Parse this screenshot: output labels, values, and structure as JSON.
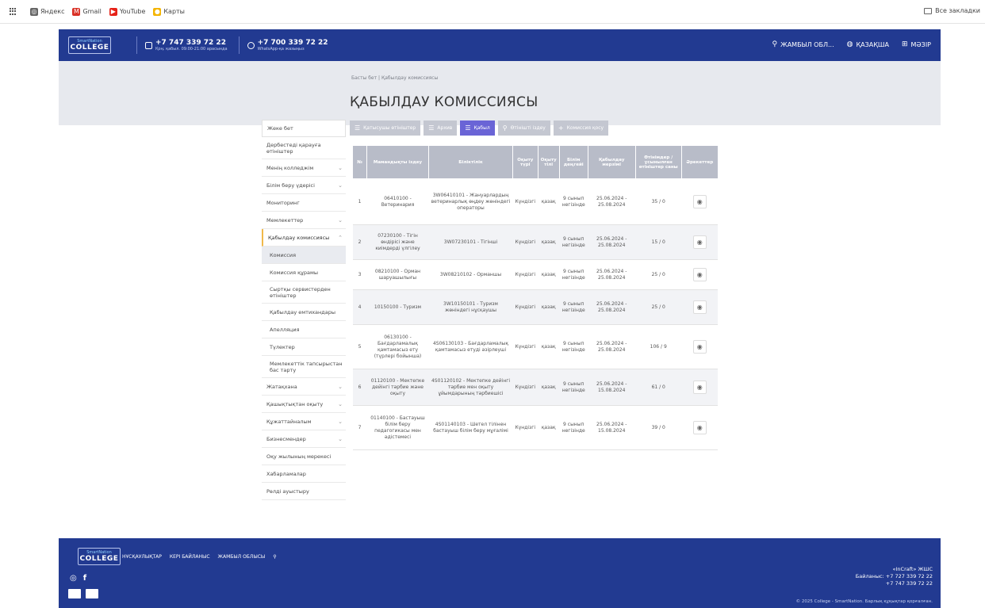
{
  "browser": {
    "bookmarks": [
      {
        "label": "Яндекс",
        "icon": "yandex-icon",
        "color": "#666666",
        "glyph": "◎"
      },
      {
        "label": "Gmail",
        "icon": "gmail-icon",
        "color": "#d93025",
        "glyph": "M"
      },
      {
        "label": "YouTube",
        "icon": "youtube-icon",
        "color": "#e62117",
        "glyph": "▶"
      },
      {
        "label": "Карты",
        "icon": "maps-pin-icon",
        "color": "#f4b400",
        "glyph": "●"
      }
    ],
    "all_bookmarks": "Все закладки"
  },
  "header": {
    "logo_brand": "SmartNation",
    "logo_word": "COLLEGE",
    "phone1": "+7 747 339 72 22",
    "phone1_sub": "Қоң. қабыл. 09:00-21:00 арасында",
    "phone2": "+7 700 339 72 22",
    "phone2_sub": "WhatsApp-қа жазыңыз",
    "region": "ЖАМБЫЛ ОБЛ...",
    "language": "ҚАЗАҚША",
    "menu": "МӘЗІР"
  },
  "page": {
    "breadcrumb": "Басты бет  |  Қабылдау комиссиясы",
    "title": "ҚАБЫЛДАУ КОМИССИЯСЫ"
  },
  "sidebar": {
    "items": [
      {
        "label": "Жеке бет",
        "chevron": ""
      },
      {
        "label": "Дербестеді қарауға өтініштер",
        "chevron": ""
      },
      {
        "label": "Менің колледжім",
        "chevron": "⌄"
      },
      {
        "label": "Білім беру үдерісі",
        "chevron": "⌄"
      },
      {
        "label": "Мониторинг",
        "chevron": ""
      },
      {
        "label": "Мемлекеттер",
        "chevron": "⌄"
      },
      {
        "label": "Қабылдау комиссиясы",
        "chevron": "⌃"
      },
      {
        "label": "Комиссия",
        "chevron": ""
      },
      {
        "label": "Комиссия құрамы",
        "chevron": ""
      },
      {
        "label": "Сыртқы сервистерден өтініштер",
        "chevron": ""
      },
      {
        "label": "Қабылдау емтихандары",
        "chevron": ""
      },
      {
        "label": "Апелляция",
        "chevron": ""
      },
      {
        "label": "Түлектер",
        "chevron": ""
      },
      {
        "label": "Мемлекеттік тапсырыстан бас тарту",
        "chevron": ""
      },
      {
        "label": "Жатақхана",
        "chevron": "⌄"
      },
      {
        "label": "Қашықтықтан оқыту",
        "chevron": "⌄"
      },
      {
        "label": "Құжаттайналым",
        "chevron": "⌄"
      },
      {
        "label": "Бизнесмендер",
        "chevron": "⌄"
      },
      {
        "label": "Оқу жылының мерекесі",
        "chevron": ""
      },
      {
        "label": "Хабарламалар",
        "chevron": ""
      },
      {
        "label": "Рөлді ауыстыру",
        "chevron": ""
      }
    ]
  },
  "tabs": [
    {
      "label": "Қатысушы өтініштер",
      "icon": "list-icon"
    },
    {
      "label": "Архив",
      "icon": "list-icon"
    },
    {
      "label": "Қабыл",
      "icon": "list-icon"
    },
    {
      "label": "Өтінішті іздеу",
      "icon": "search-icon"
    },
    {
      "label": "Комиссия қосу",
      "icon": "plus-icon"
    }
  ],
  "table": {
    "headers": [
      "№",
      "Мамандықты іздеу",
      "Біліктілік",
      "Оқыту түрі",
      "Оқыту тілі",
      "Білім деңгейі",
      "Қабылдау мерзімі",
      "Өтінімдер / ұсынылған өтініштер саны",
      "Әрекеттер"
    ],
    "rows": [
      {
        "no": "1",
        "spec": "06410100 - Ветеринария",
        "qual": "3W06410101 - Жануарлардың ветеринарлық өңдеу жөніндегі операторы",
        "form": "Күндізгі",
        "lang": "қазақ",
        "level": "9 сынып негізінде",
        "period": "25.06.2024 - 25.08.2024",
        "count": "35 / 0"
      },
      {
        "no": "2",
        "spec": "07230100 - Тігін өндірісі және киімдерді үлгілеу",
        "qual": "3W07230101 - Тігінші",
        "form": "Күндізгі",
        "lang": "қазақ",
        "level": "9 сынып негізінде",
        "period": "25.06.2024 - 25.08.2024",
        "count": "15 / 0"
      },
      {
        "no": "3",
        "spec": "08210100 - Орман шаруашылығы",
        "qual": "3W08210102 - Орманшы",
        "form": "Күндізгі",
        "lang": "қазақ",
        "level": "9 сынып негізінде",
        "period": "25.06.2024 - 25.08.2024",
        "count": "25 / 0"
      },
      {
        "no": "4",
        "spec": "10150100 - Туризм",
        "qual": "3W10150101 - Туризм жөніндегі нұсқаушы",
        "form": "Күндізгі",
        "lang": "қазақ",
        "level": "9 сынып негізінде",
        "period": "25.06.2024 - 25.08.2024",
        "count": "25 / 0"
      },
      {
        "no": "5",
        "spec": "06130100 - Бағдарламалық қамтамасыз ету (түрлері бойынша)",
        "qual": "4S06130103 - Бағдарламалық қамтамасыз етуді әзірлеуші",
        "form": "Күндізгі",
        "lang": "қазақ",
        "level": "9 сынып негізінде",
        "period": "25.06.2024 - 25.08.2024",
        "count": "106 / 9"
      },
      {
        "no": "6",
        "spec": "01120100 - Мектепке дейінгі тәрбие және оқыту",
        "qual": "4S01120102 - Мектепке дейінгі тәрбие мен оқыту ұйымдарының тәрбиешісі",
        "form": "Күндізгі",
        "lang": "қазақ",
        "level": "9 сынып негізінде",
        "period": "25.06.2024 - 15.08.2024",
        "count": "61 / 0"
      },
      {
        "no": "7",
        "spec": "01140100 - Бастауыш білім беру педагогикасы мен әдістемесі",
        "qual": "4S01140103 - Шетел тілінен бастауыш білім беру мұғалімі",
        "form": "Күндізгі",
        "lang": "қазақ",
        "level": "9 сынып негізінде",
        "period": "25.06.2024 - 15.08.2024",
        "count": "39 / 0"
      }
    ]
  },
  "footer": {
    "links": [
      "НҰСҚАУЛЫҚТАР",
      "КЕРІ БАЙЛАНЫС",
      "ЖАМБЫЛ ОБЛЫСЫ"
    ],
    "company": "«InCraft» ЖШС",
    "contact_line1": "Байланыс: +7 727 339 72 22",
    "contact_line2": "+7 747 339 72 22",
    "copyright": "© 2025 College - SmartNation. Барлық құқықтар қорғалған."
  },
  "colors": {
    "header_blue": "#223a91",
    "tab_active": "#6a64d6",
    "tab_inactive": "#c4c7d1",
    "sidebar_accent": "#f0b94a"
  }
}
